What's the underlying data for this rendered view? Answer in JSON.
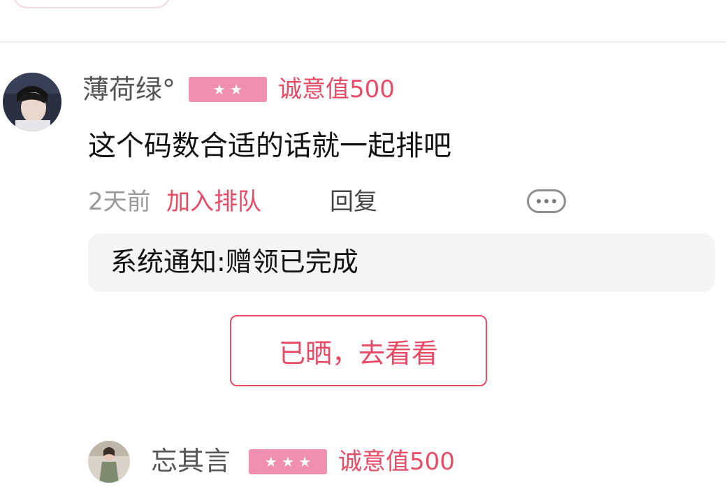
{
  "comments": [
    {
      "username": "薄荷绿°",
      "stars": "★ ★",
      "sincerity": "诚意值500",
      "text": "这个码数合适的话就一起排吧",
      "time": "2天前",
      "queue_label": "加入排队",
      "reply_label": "回复",
      "notice": "系统通知:赠领已完成",
      "action_label": "已晒，去看看"
    },
    {
      "username": "忘其言",
      "stars": "★ ★ ★",
      "sincerity": "诚意值500"
    }
  ],
  "colors": {
    "accent": "#e84b66",
    "badge": "#f08fb0",
    "notice_bg": "#f4f4f4"
  },
  "icons": {
    "more": "more-dots-icon"
  }
}
